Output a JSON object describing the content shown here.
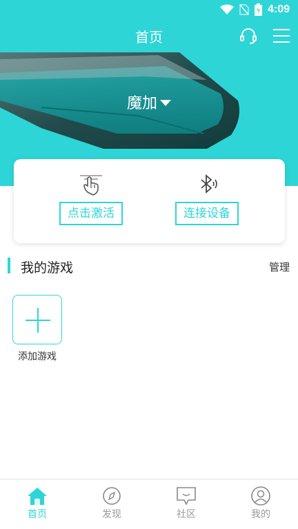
{
  "status_bar": {
    "time": "4:09"
  },
  "header": {
    "title": "首页"
  },
  "banner": {
    "device_name": "魔加"
  },
  "card": {
    "activate_label": "点击激活",
    "connect_label": "连接设备"
  },
  "games": {
    "title": "我的游戏",
    "manage_label": "管理",
    "add_label": "添加游戏"
  },
  "bottom_nav": {
    "items": [
      {
        "label": "首页",
        "icon": "home-icon",
        "active": true
      },
      {
        "label": "发现",
        "icon": "compass-icon",
        "active": false
      },
      {
        "label": "社区",
        "icon": "chat-bubble-icon",
        "active": false
      },
      {
        "label": "我的",
        "icon": "user-icon",
        "active": false
      }
    ]
  },
  "colors": {
    "accent": "#2ed5d6",
    "inactive": "#999999"
  }
}
